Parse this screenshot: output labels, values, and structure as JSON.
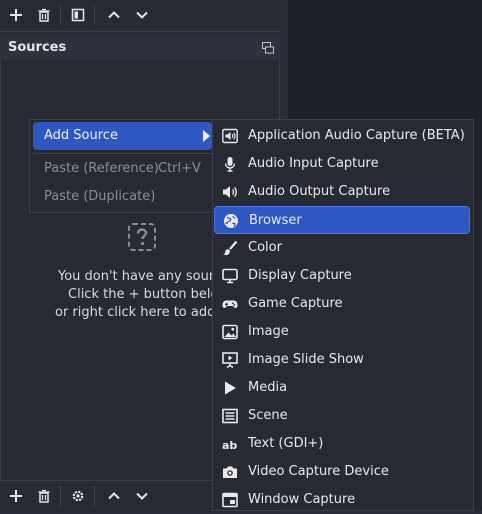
{
  "colors": {
    "accent": "#2f57c2",
    "panel": "#272a33",
    "background": "#2b2e38",
    "text": "#e4e4e6",
    "muted": "#8b8d96"
  },
  "top_toolbar": {
    "icons": [
      "plus-icon",
      "trash-icon",
      "filter-icon",
      "arrow-up-icon",
      "arrow-down-icon"
    ]
  },
  "sources": {
    "title": "Sources",
    "empty": {
      "line1": "You don't have any source",
      "line2": "Click the + button below",
      "line3": "or right click here to add or"
    }
  },
  "bottom_toolbar": {
    "icons": [
      "plus-icon",
      "trash-icon",
      "gear-icon",
      "arrow-up-icon",
      "arrow-down-icon"
    ]
  },
  "context_menu": {
    "add_source": "Add Source",
    "paste_reference": "Paste (Reference)",
    "paste_reference_shortcut": "Ctrl+V",
    "paste_duplicate": "Paste (Duplicate)"
  },
  "submenu": {
    "items": [
      {
        "label": "Application Audio Capture (BETA)",
        "icon": "app-audio-icon"
      },
      {
        "label": "Audio Input Capture",
        "icon": "microphone-icon"
      },
      {
        "label": "Audio Output Capture",
        "icon": "speaker-icon"
      },
      {
        "label": "Browser",
        "icon": "globe-icon"
      },
      {
        "label": "Color",
        "icon": "brush-icon"
      },
      {
        "label": "Display Capture",
        "icon": "monitor-icon"
      },
      {
        "label": "Game Capture",
        "icon": "gamepad-icon"
      },
      {
        "label": "Image",
        "icon": "image-icon"
      },
      {
        "label": "Image Slide Show",
        "icon": "slideshow-icon"
      },
      {
        "label": "Media",
        "icon": "play-icon"
      },
      {
        "label": "Scene",
        "icon": "scene-icon"
      },
      {
        "label": "Text (GDI+)",
        "icon": "text-icon"
      },
      {
        "label": "Video Capture Device",
        "icon": "camera-icon"
      },
      {
        "label": "Window Capture",
        "icon": "window-icon"
      }
    ],
    "selected": "Browser"
  }
}
